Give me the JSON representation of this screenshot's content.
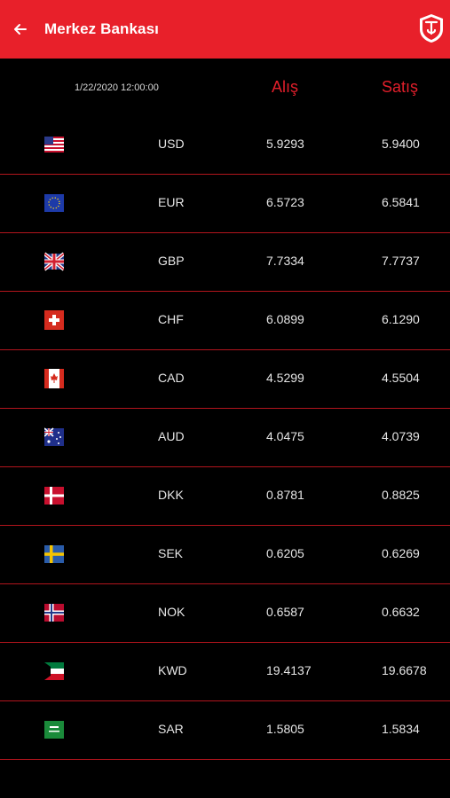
{
  "appbar": {
    "title": "Merkez Bankası"
  },
  "header": {
    "date": "1/22/2020 12:00:00",
    "buy_label": "Alış",
    "sell_label": "Satış"
  },
  "rates": [
    {
      "code": "USD",
      "buy": "5.9293",
      "sell": "5.9400",
      "flag": "usd-flag-icon"
    },
    {
      "code": "EUR",
      "buy": "6.5723",
      "sell": "6.5841",
      "flag": "eur-flag-icon"
    },
    {
      "code": "GBP",
      "buy": "7.7334",
      "sell": "7.7737",
      "flag": "gbp-flag-icon"
    },
    {
      "code": "CHF",
      "buy": "6.0899",
      "sell": "6.1290",
      "flag": "chf-flag-icon"
    },
    {
      "code": "CAD",
      "buy": "4.5299",
      "sell": "4.5504",
      "flag": "cad-flag-icon"
    },
    {
      "code": "AUD",
      "buy": "4.0475",
      "sell": "4.0739",
      "flag": "aud-flag-icon"
    },
    {
      "code": "DKK",
      "buy": "0.8781",
      "sell": "0.8825",
      "flag": "dkk-flag-icon"
    },
    {
      "code": "SEK",
      "buy": "0.6205",
      "sell": "0.6269",
      "flag": "sek-flag-icon"
    },
    {
      "code": "NOK",
      "buy": "0.6587",
      "sell": "0.6632",
      "flag": "nok-flag-icon"
    },
    {
      "code": "KWD",
      "buy": "19.4137",
      "sell": "19.6678",
      "flag": "kwd-flag-icon"
    },
    {
      "code": "SAR",
      "buy": "1.5805",
      "sell": "1.5834",
      "flag": "sar-flag-icon"
    }
  ],
  "colors": {
    "appbar": "#e8202a",
    "accent": "#e31f2b",
    "divider": "#b3151d",
    "background": "#000000"
  }
}
